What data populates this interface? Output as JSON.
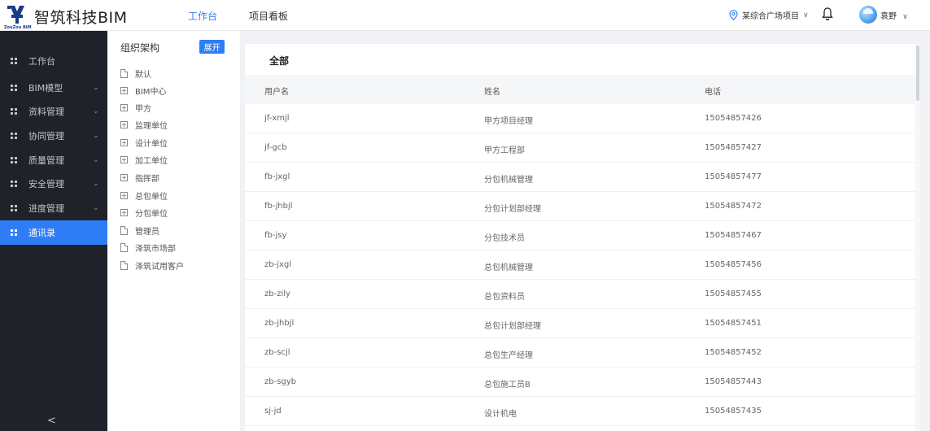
{
  "header": {
    "brand": "智筑科技BIM",
    "logo_caption": "ZouZou BIM",
    "tabs": [
      {
        "label": "工作台",
        "active": true
      },
      {
        "label": "项目看板",
        "active": false
      }
    ],
    "project": "某综合广场项目",
    "project_chevron": "∨",
    "user_name": "袁野",
    "user_chevron": "∨"
  },
  "sidebar": {
    "items": [
      {
        "label": "工作台",
        "chevron": ""
      },
      {
        "label": "BIM模型",
        "chevron": "⌄"
      },
      {
        "label": "资料管理",
        "chevron": "⌄"
      },
      {
        "label": "协同管理",
        "chevron": "⌄"
      },
      {
        "label": "质量管理",
        "chevron": "⌄"
      },
      {
        "label": "安全管理",
        "chevron": "⌄"
      },
      {
        "label": "进度管理",
        "chevron": "⌄"
      },
      {
        "label": "通讯录",
        "chevron": "",
        "active": true
      }
    ],
    "collapse_glyph": "<"
  },
  "tree": {
    "title": "组织架构",
    "expand_label": "展开",
    "nodes": [
      {
        "label": "默认",
        "icon": "doc"
      },
      {
        "label": "BIM中心",
        "icon": "plus-box"
      },
      {
        "label": "甲方",
        "icon": "plus-box"
      },
      {
        "label": "监理单位",
        "icon": "plus-box"
      },
      {
        "label": "设计单位",
        "icon": "plus-box"
      },
      {
        "label": "加工单位",
        "icon": "plus-box"
      },
      {
        "label": "指挥部",
        "icon": "plus-box"
      },
      {
        "label": "总包单位",
        "icon": "plus-box"
      },
      {
        "label": "分包单位",
        "icon": "plus-box"
      },
      {
        "label": "管理员",
        "icon": "doc"
      },
      {
        "label": "泽筑市场部",
        "icon": "doc"
      },
      {
        "label": "泽筑试用客户",
        "icon": "doc"
      }
    ]
  },
  "panel": {
    "title": "全部",
    "columns": [
      "用户名",
      "姓名",
      "电话"
    ],
    "rows": [
      [
        "jf-xmjl",
        "甲方项目经理",
        "15054857426"
      ],
      [
        "jf-gcb",
        "甲方工程部",
        "15054857427"
      ],
      [
        "fb-jxgl",
        "分包机械管理",
        "15054857477"
      ],
      [
        "fb-jhbjl",
        "分包计划部经理",
        "15054857472"
      ],
      [
        "fb-jsy",
        "分包技术员",
        "15054857467"
      ],
      [
        "zb-jxgl",
        "总包机械管理",
        "15054857456"
      ],
      [
        "zb-zily",
        "总包资料员",
        "15054857455"
      ],
      [
        "zb-jhbjl",
        "总包计划部经理",
        "15054857451"
      ],
      [
        "zb-scjl",
        "总包生产经理",
        "15054857452"
      ],
      [
        "zb-sgyb",
        "总包施工员B",
        "15054857443"
      ],
      [
        "sj-jd",
        "设计机电",
        "15054857435"
      ]
    ]
  },
  "colors": {
    "accent": "#2f7df6",
    "sidebar_bg": "#1f2329"
  }
}
